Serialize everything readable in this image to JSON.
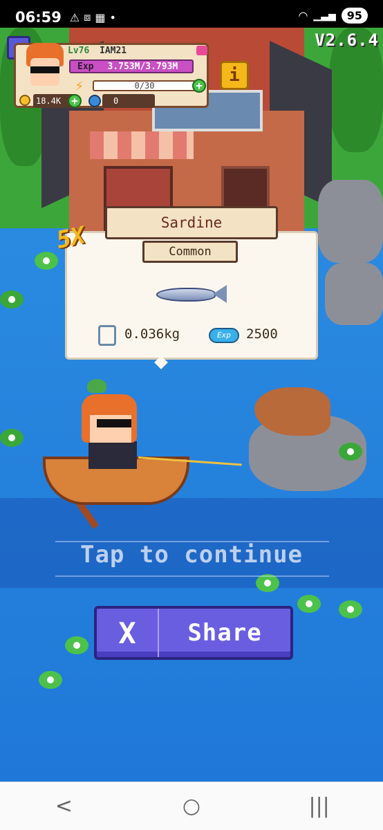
{
  "status_bar": {
    "time": "06:59",
    "battery": "95",
    "icons": [
      "warning-icon",
      "screenshot-icon",
      "calendar-icon",
      "dot-icon",
      "wifi-icon",
      "signal-icon"
    ]
  },
  "hud": {
    "version": "V2.6.4",
    "level": "Lv76",
    "username": "IAM21",
    "exp_label": "Exp",
    "exp_value": "3.753M/3.793M",
    "energy_value": "0/30",
    "coins": "18.4K",
    "gems": "0",
    "info_label": "i"
  },
  "catch": {
    "multiplier": "5X",
    "fish_name": "Sardine",
    "rarity": "Common",
    "weight": "0.036kg",
    "exp_chip": "Exp",
    "exp_reward": "2500"
  },
  "tap_to_continue": "Tap to continue",
  "share": {
    "x_label": "X",
    "label": "Share"
  },
  "nav": {
    "back": "<",
    "home": "○",
    "recents": "|||"
  },
  "colors": {
    "water": "#2a8ee6",
    "share_button": "#6a5ee0",
    "exp_bar": "#c94fc4",
    "gold": "#f5b81a"
  }
}
